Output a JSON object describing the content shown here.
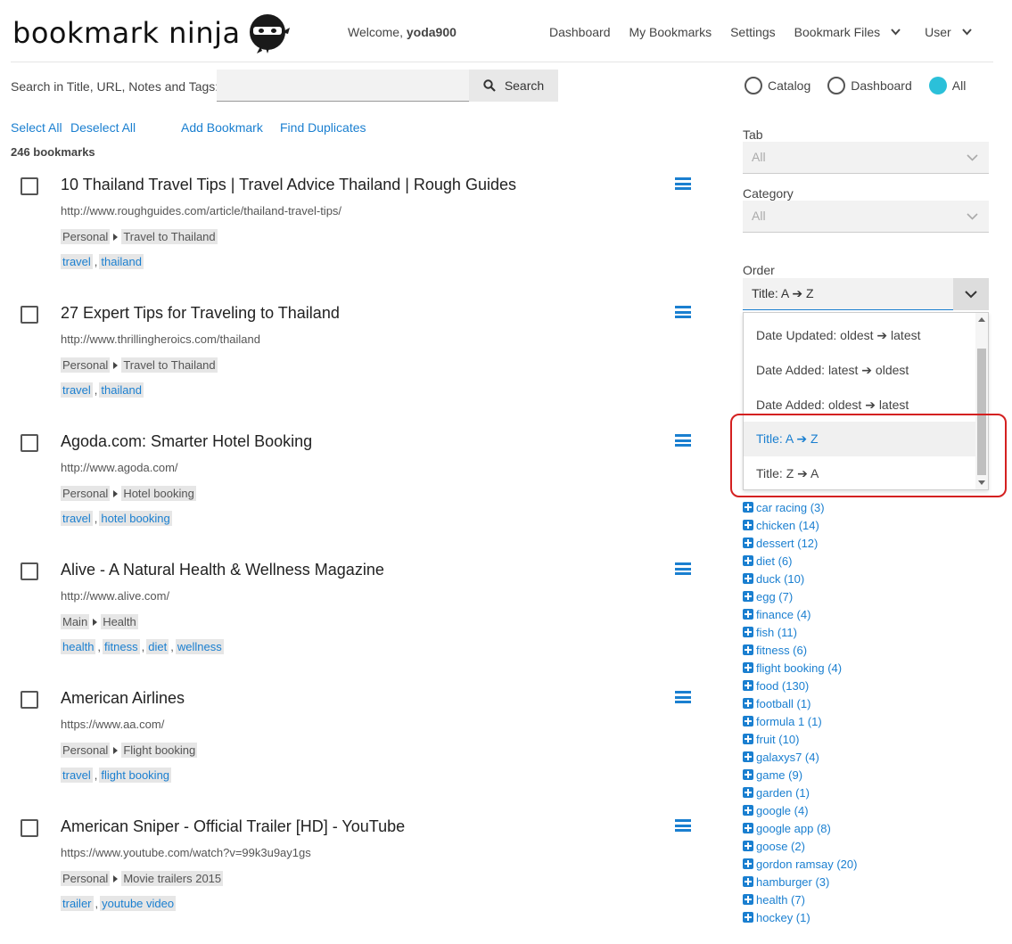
{
  "header": {
    "logo_text": "bookmark ninja",
    "welcome_prefix": "Welcome, ",
    "username": "yoda900",
    "nav": [
      "Dashboard",
      "My Bookmarks",
      "Settings",
      "Bookmark Files",
      "User"
    ]
  },
  "search": {
    "label": "Search in Title, URL, Notes and Tags:",
    "value": "",
    "button_label": "Search"
  },
  "scope": {
    "options": [
      "Catalog",
      "Dashboard",
      "All"
    ],
    "selected": "All",
    "accent": "#2bc0d9"
  },
  "actions": {
    "select_all": "Select All",
    "deselect_all": "Deselect All",
    "add_bookmark": "Add Bookmark",
    "find_duplicates": "Find Duplicates"
  },
  "bookmark_count": "246 bookmarks",
  "bookmarks": [
    {
      "title": "10 Thailand Travel Tips | Travel Advice Thailand | Rough Guides",
      "url": "http://www.roughguides.com/article/thailand-travel-tips/",
      "tab": "Personal",
      "category": "Travel to Thailand",
      "tags": [
        "travel",
        "thailand"
      ]
    },
    {
      "title": "27 Expert Tips for Traveling to Thailand",
      "url": "http://www.thrillingheroics.com/thailand",
      "tab": "Personal",
      "category": "Travel to Thailand",
      "tags": [
        "travel",
        "thailand"
      ]
    },
    {
      "title": "Agoda.com: Smarter Hotel Booking",
      "url": "http://www.agoda.com/",
      "tab": "Personal",
      "category": "Hotel booking",
      "tags": [
        "travel",
        "hotel booking"
      ]
    },
    {
      "title": "Alive - A Natural Health & Wellness Magazine",
      "url": "http://www.alive.com/",
      "tab": "Main",
      "category": "Health",
      "tags": [
        "health",
        "fitness",
        "diet",
        "wellness"
      ]
    },
    {
      "title": "American Airlines",
      "url": "https://www.aa.com/",
      "tab": "Personal",
      "category": "Flight booking",
      "tags": [
        "travel",
        "flight booking"
      ]
    },
    {
      "title": "American Sniper - Official Trailer [HD] - YouTube",
      "url": "https://www.youtube.com/watch?v=99k3u9ay1gs",
      "tab": "Personal",
      "category": "Movie trailers 2015",
      "tags": [
        "trailer",
        "youtube video"
      ]
    }
  ],
  "filters": {
    "tab_label": "Tab",
    "tab_value": "All",
    "category_label": "Category",
    "category_value": "All",
    "order_label": "Order",
    "order_value": "Title: A ➔ Z"
  },
  "order_options": [
    "Date Updated: oldest ➔ latest",
    "Date Added: latest ➔ oldest",
    "Date Added: oldest ➔ latest",
    "Title: A ➔ Z",
    "Title: Z ➔ A"
  ],
  "order_selected_index": 3,
  "tag_list": [
    "car racing (3)",
    "chicken (14)",
    "dessert (12)",
    "diet (6)",
    "duck (10)",
    "egg (7)",
    "finance (4)",
    "fish (11)",
    "fitness (6)",
    "flight booking (4)",
    "food (130)",
    "football (1)",
    "formula 1 (1)",
    "fruit (10)",
    "galaxys7 (4)",
    "game (9)",
    "garden (1)",
    "google (4)",
    "google app (8)",
    "goose (2)",
    "gordon ramsay (20)",
    "hamburger (3)",
    "health (7)",
    "hockey (1)"
  ],
  "colors": {
    "link": "#1a7fd0",
    "highlight_border": "#d42020"
  }
}
